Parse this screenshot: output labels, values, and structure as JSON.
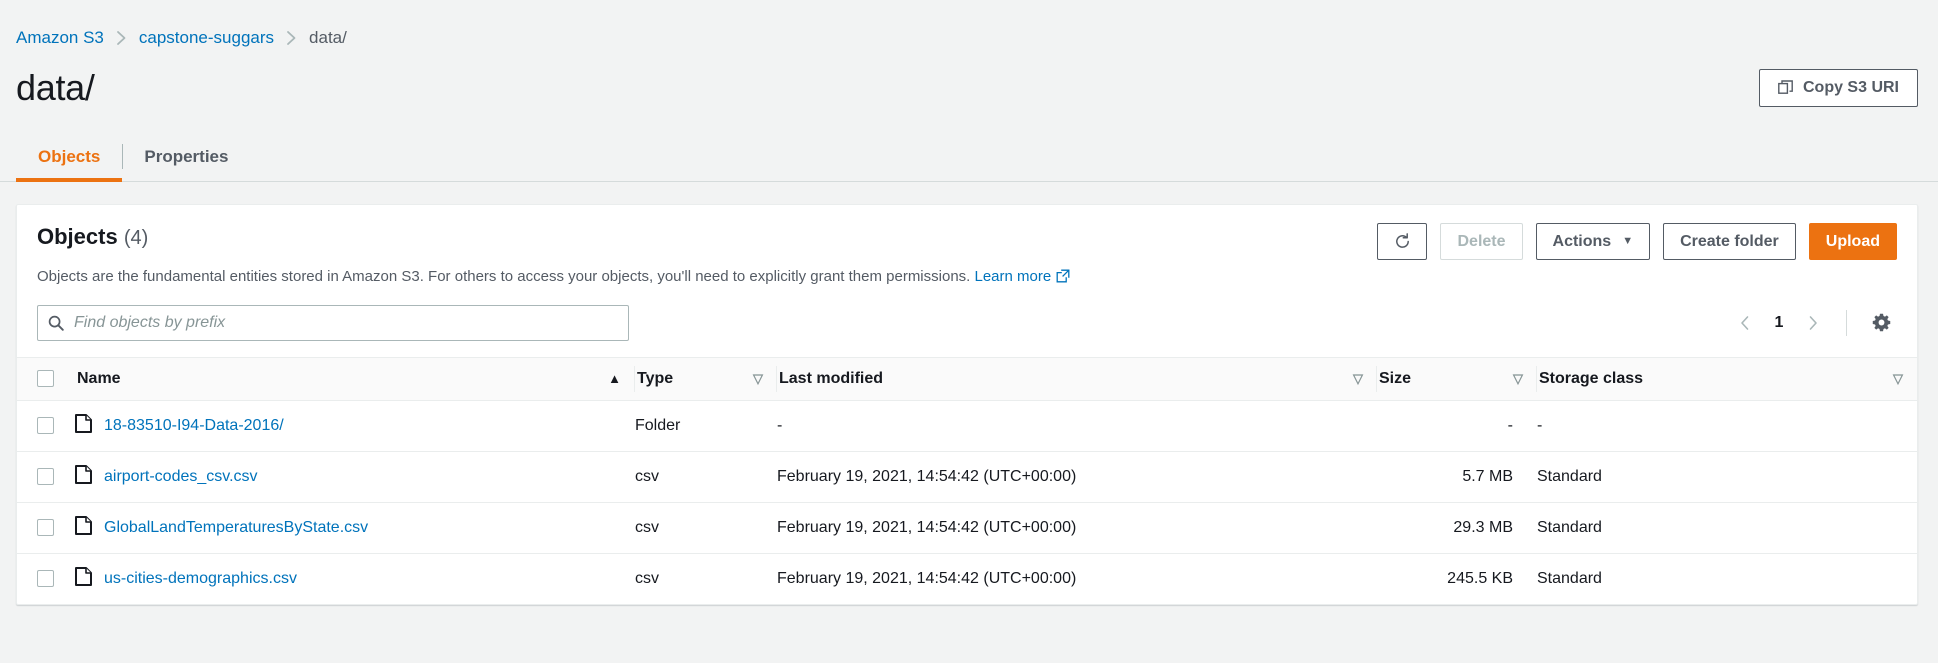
{
  "breadcrumb": {
    "items": [
      {
        "label": "Amazon S3",
        "type": "link"
      },
      {
        "label": "capstone-suggars",
        "type": "link"
      },
      {
        "label": "data/",
        "type": "current"
      }
    ]
  },
  "header": {
    "title": "data/",
    "copy_uri_label": "Copy S3 URI"
  },
  "tabs": [
    {
      "label": "Objects",
      "active": true
    },
    {
      "label": "Properties",
      "active": false
    }
  ],
  "objects_panel": {
    "heading": "Objects",
    "count": "(4)",
    "description": "Objects are the fundamental entities stored in Amazon S3. For others to access your objects, you'll need to explicitly grant them permissions.",
    "learn_more_label": "Learn more",
    "buttons": {
      "refresh_icon": "refresh-icon",
      "delete_label": "Delete",
      "actions_label": "Actions",
      "create_folder_label": "Create folder",
      "upload_label": "Upload"
    },
    "search": {
      "placeholder": "Find objects by prefix",
      "value": ""
    },
    "pagination": {
      "prev_icon": "chevron-left-icon",
      "page": "1",
      "next_icon": "chevron-right-icon",
      "settings_icon": "gear-icon"
    },
    "table": {
      "columns": [
        {
          "label": "Name",
          "sort": "asc"
        },
        {
          "label": "Type",
          "sort": "none"
        },
        {
          "label": "Last modified",
          "sort": "none"
        },
        {
          "label": "Size",
          "sort": "none"
        },
        {
          "label": "Storage class",
          "sort": "none"
        }
      ],
      "rows": [
        {
          "name": "18-83510-I94-Data-2016/",
          "type": "Folder",
          "last_modified": "-",
          "size": "-",
          "storage_class": "-"
        },
        {
          "name": "airport-codes_csv.csv",
          "type": "csv",
          "last_modified": "February 19, 2021, 14:54:42 (UTC+00:00)",
          "size": "5.7 MB",
          "storage_class": "Standard"
        },
        {
          "name": "GlobalLandTemperaturesByState.csv",
          "type": "csv",
          "last_modified": "February 19, 2021, 14:54:42 (UTC+00:00)",
          "size": "29.3 MB",
          "storage_class": "Standard"
        },
        {
          "name": "us-cities-demographics.csv",
          "type": "csv",
          "last_modified": "February 19, 2021, 14:54:42 (UTC+00:00)",
          "size": "245.5 KB",
          "storage_class": "Standard"
        }
      ]
    }
  },
  "colors": {
    "accent_orange": "#ec7211",
    "link_blue": "#0073bb",
    "text_dark": "#16191f",
    "text_muted": "#545b64",
    "page_background": "#f2f3f3"
  }
}
